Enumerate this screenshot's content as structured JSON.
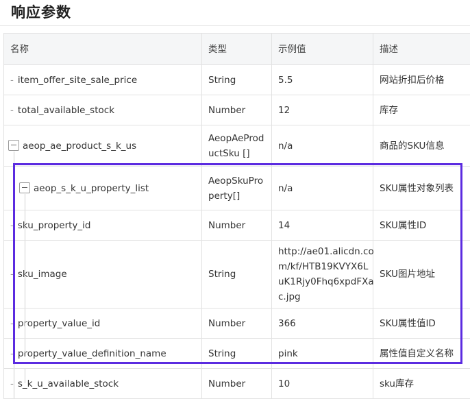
{
  "page": {
    "title": "响应参数"
  },
  "table": {
    "headers": {
      "name": "名称",
      "type": "类型",
      "example": "示例值",
      "description": "描述"
    },
    "rows": [
      {
        "name": "item_offer_site_sale_price",
        "type": "String",
        "example": "5.5",
        "description": "网站折扣后价格"
      },
      {
        "name": "total_available_stock",
        "type": "Number",
        "example": "12",
        "description": "库存"
      },
      {
        "name": "aeop_ae_product_s_k_us",
        "type_line1": "AeopAeProd",
        "type_line2": "uctSku []",
        "example": "n/a",
        "description": "商品的SKU信息"
      },
      {
        "name": "aeop_s_k_u_property_list",
        "type_line1": "AeopSkuPro",
        "type_line2": "perty[]",
        "example": "n/a",
        "description": "SKU属性对象列表"
      },
      {
        "name": "sku_property_id",
        "type": "Number",
        "example": "14",
        "description": "SKU属性ID"
      },
      {
        "name": "sku_image",
        "type": "String",
        "example_line1": "http://ae01.alicdn.co",
        "example_line2": "m/kf/HTB19KVYX6L",
        "example_line3": "uK1Rjy0Fhq6xpdFXa",
        "example_line4": "c.jpg",
        "description": "SKU图片地址"
      },
      {
        "name": "property_value_id",
        "type": "Number",
        "example": "366",
        "description": "SKU属性值ID"
      },
      {
        "name": "property_value_definition_name",
        "type": "String",
        "example": "pink",
        "description": "属性值自定义名称"
      },
      {
        "name": "s_k_u_available_stock",
        "type": "Number",
        "example": "10",
        "description": "sku库存"
      }
    ]
  },
  "highlight_color": "#5b2be0"
}
